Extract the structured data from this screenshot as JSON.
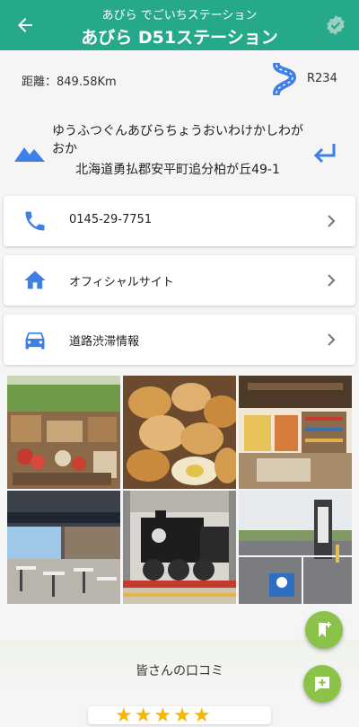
{
  "header": {
    "subtitle": "あびら でごいちステーション",
    "title": "あびら D51ステーション"
  },
  "info": {
    "distance": "距離：849.58Km",
    "route": "R234"
  },
  "address": {
    "kana": "ゆうふつぐんあびらちょうおいわけかしわがおか",
    "text": "北海道勇払郡安平町追分柏が丘49-1"
  },
  "links": {
    "phone": "0145-29-7751",
    "official_site": "オフィシャルサイト",
    "traffic": "道路渋滞情報"
  },
  "reviews": {
    "title": "皆さんの口コミ",
    "rating": "★★★★★"
  },
  "colors": {
    "header_bg": "#26a98a",
    "icon_blue": "#3f80e6",
    "fab_green": "#8bc34a"
  }
}
